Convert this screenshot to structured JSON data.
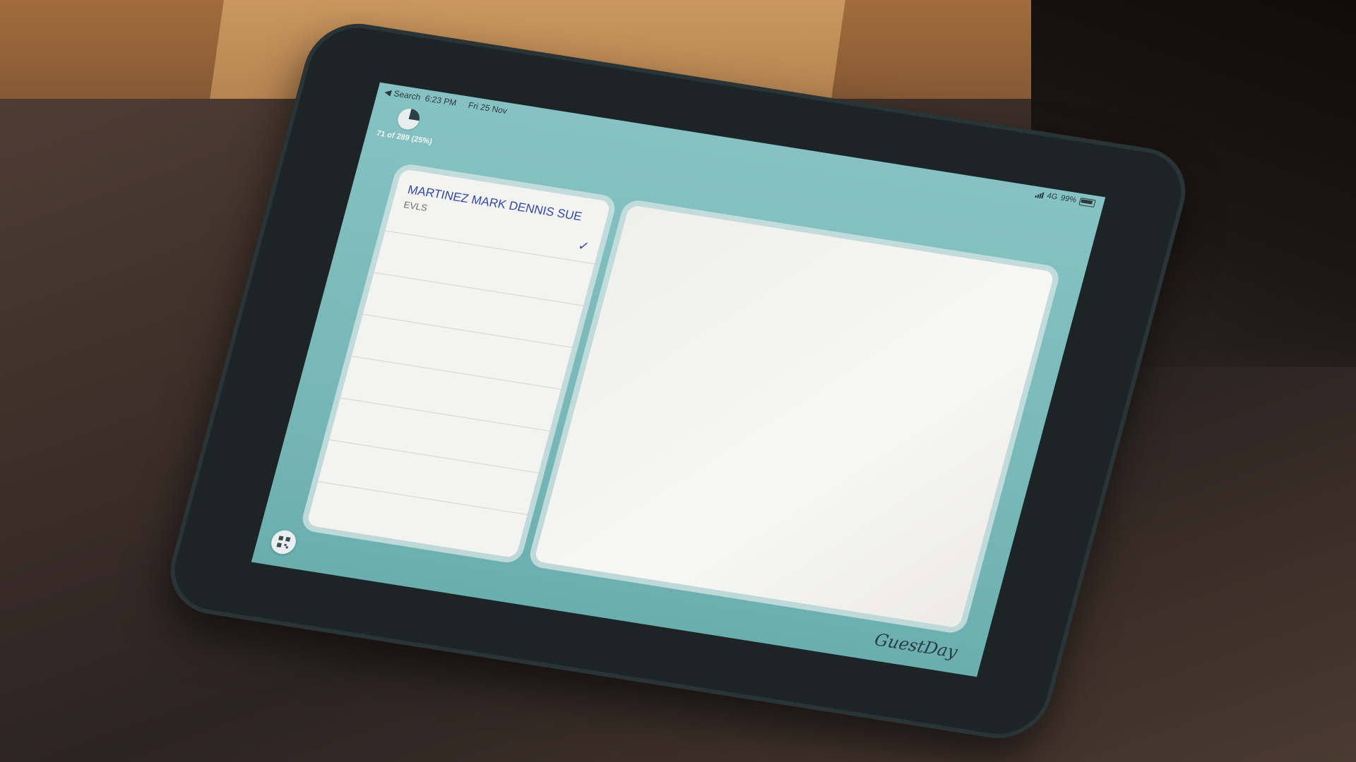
{
  "status_bar": {
    "back_label": "Search",
    "time": "6:23 PM",
    "date": "Fri 25 Nov",
    "network": "4G",
    "battery": "99%"
  },
  "progress": {
    "label": "71 of 289 (25%)",
    "fraction": 0.25
  },
  "guest_list": {
    "items": [
      {
        "name": "MARTINEZ MARK DENNIS SUE",
        "subtitle": "EVLS",
        "selected": true
      }
    ],
    "empty_rows": 6
  },
  "icons": {
    "back": "chevron-left-icon",
    "progress": "pie-chart-icon",
    "check": "checkmark-icon",
    "qr": "qr-code-icon"
  },
  "brand": {
    "name": "GuestDay"
  },
  "colors": {
    "screen_background": "#79b8b8",
    "accent_text": "#3548a6",
    "panel_background": "#f3f3f1"
  }
}
